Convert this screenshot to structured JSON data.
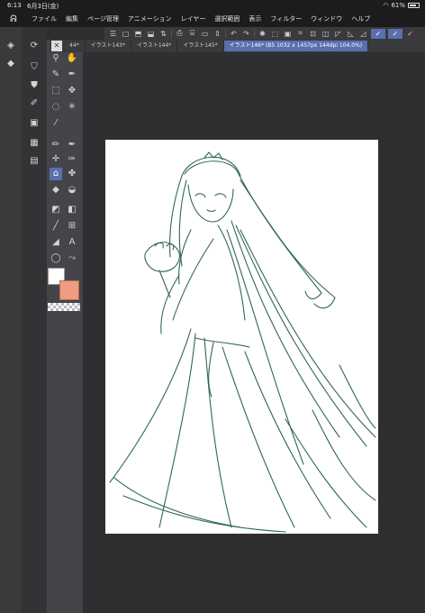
{
  "status": {
    "time": "6:13",
    "date": "6月3日(金)",
    "battery": "61%"
  },
  "menu": [
    "ファイル",
    "編集",
    "ページ管理",
    "アニメーション",
    "レイヤー",
    "選択範囲",
    "表示",
    "フィルター",
    "ウィンドウ",
    "ヘルプ"
  ],
  "tabs": [
    {
      "label": "44*"
    },
    {
      "label": "イラスト143*"
    },
    {
      "label": "イラスト144*"
    },
    {
      "label": "イラスト145*"
    },
    {
      "label": "イラスト146* (B5 1032 x 1457px 144dpi 104.0%)",
      "active": true
    }
  ],
  "colors": {
    "accent": "#5a6fae",
    "main_color": "#ffffff",
    "sub_color": "#f19b80",
    "sketch": "#1f5a48"
  }
}
